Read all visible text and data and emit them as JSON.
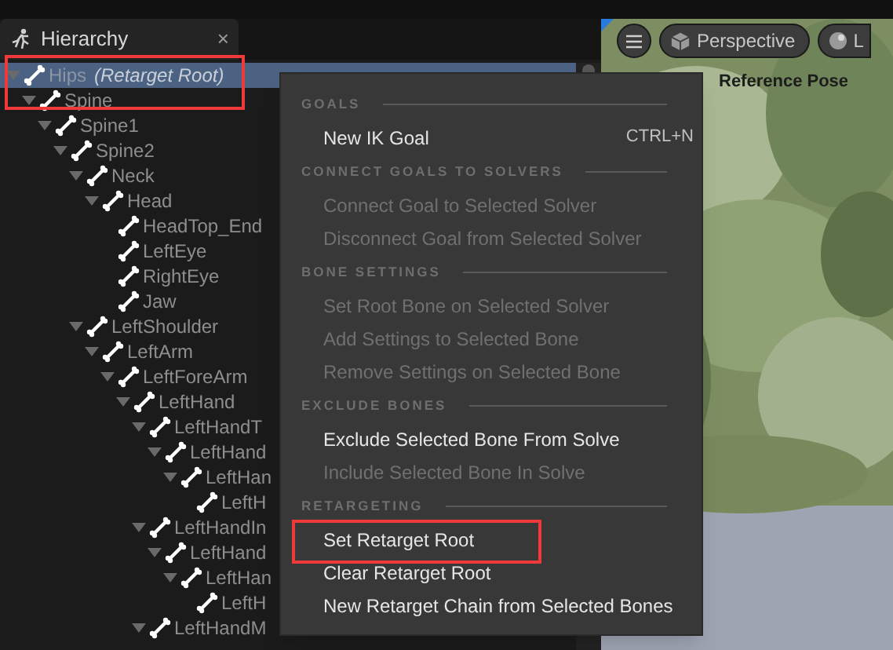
{
  "hierarchy_tab": {
    "title": "Hierarchy",
    "close": "×"
  },
  "tree": [
    {
      "label": "Hips",
      "suffix": "(Retarget Root)",
      "selected": true,
      "expanded": true,
      "children": [
        {
          "label": "Spine",
          "selected": false,
          "expanded": true,
          "children": [
            {
              "label": "Spine1",
              "selected": false,
              "expanded": true,
              "children": [
                {
                  "label": "Spine2",
                  "selected": false,
                  "expanded": true,
                  "children": [
                    {
                      "label": "Neck",
                      "selected": false,
                      "expanded": true,
                      "children": [
                        {
                          "label": "Head",
                          "selected": false,
                          "expanded": true,
                          "children": [
                            {
                              "label": "HeadTop_End",
                              "selected": false
                            },
                            {
                              "label": "LeftEye",
                              "selected": false
                            },
                            {
                              "label": "RightEye",
                              "selected": false
                            },
                            {
                              "label": "Jaw",
                              "selected": false
                            }
                          ]
                        }
                      ]
                    },
                    {
                      "label": "LeftShoulder",
                      "selected": false,
                      "expanded": true,
                      "children": [
                        {
                          "label": "LeftArm",
                          "selected": false,
                          "expanded": true,
                          "children": [
                            {
                              "label": "LeftForeArm",
                              "selected": false,
                              "expanded": true,
                              "children": [
                                {
                                  "label": "LeftHand",
                                  "selected": false,
                                  "expanded": true,
                                  "children": [
                                    {
                                      "label": "LeftHandT",
                                      "selected": false,
                                      "expanded": true,
                                      "children": [
                                        {
                                          "label": "LeftHand",
                                          "selected": false,
                                          "expanded": true,
                                          "children": [
                                            {
                                              "label": "LeftHan",
                                              "selected": false,
                                              "expanded": true,
                                              "children": [
                                                {
                                                  "label": "LeftH",
                                                  "selected": false
                                                }
                                              ]
                                            }
                                          ]
                                        }
                                      ]
                                    },
                                    {
                                      "label": "LeftHandIn",
                                      "selected": false,
                                      "expanded": true,
                                      "children": [
                                        {
                                          "label": "LeftHand",
                                          "selected": false,
                                          "expanded": true,
                                          "children": [
                                            {
                                              "label": "LeftHan",
                                              "selected": false,
                                              "expanded": true,
                                              "children": [
                                                {
                                                  "label": "LeftH",
                                                  "selected": false
                                                }
                                              ]
                                            }
                                          ]
                                        }
                                      ]
                                    },
                                    {
                                      "label": "LeftHandM",
                                      "selected": false,
                                      "expanded": true
                                    }
                                  ]
                                }
                              ]
                            }
                          ]
                        }
                      ]
                    }
                  ]
                }
              ]
            }
          ]
        }
      ]
    }
  ],
  "viewport": {
    "buttons": [
      {
        "kind": "menu"
      },
      {
        "kind": "camera",
        "label": "Perspective"
      },
      {
        "kind": "lit",
        "label": "L"
      }
    ],
    "overlay_text": "Reference Pose"
  },
  "context_menu": [
    {
      "kind": "header",
      "label": "GOALS"
    },
    {
      "kind": "item",
      "label": "New IK Goal",
      "shortcut": "CTRL+N",
      "disabled": false
    },
    {
      "kind": "header",
      "label": "CONNECT GOALS TO SOLVERS"
    },
    {
      "kind": "item",
      "label": "Connect Goal to Selected Solver",
      "disabled": true
    },
    {
      "kind": "item",
      "label": "Disconnect Goal from Selected Solver",
      "disabled": true
    },
    {
      "kind": "header",
      "label": "BONE SETTINGS"
    },
    {
      "kind": "item",
      "label": "Set Root Bone on Selected Solver",
      "disabled": true
    },
    {
      "kind": "item",
      "label": "Add Settings to Selected Bone",
      "disabled": true
    },
    {
      "kind": "item",
      "label": "Remove Settings on Selected Bone",
      "disabled": true
    },
    {
      "kind": "header",
      "label": "EXCLUDE BONES"
    },
    {
      "kind": "item",
      "label": "Exclude Selected Bone From Solve",
      "disabled": false
    },
    {
      "kind": "item",
      "label": "Include Selected Bone In Solve",
      "disabled": true
    },
    {
      "kind": "header",
      "label": "RETARGETING"
    },
    {
      "kind": "item",
      "label": "Set Retarget Root",
      "disabled": false
    },
    {
      "kind": "item",
      "label": "Clear Retarget Root",
      "disabled": false
    },
    {
      "kind": "item",
      "label": "New Retarget Chain from Selected Bones",
      "disabled": false
    }
  ]
}
